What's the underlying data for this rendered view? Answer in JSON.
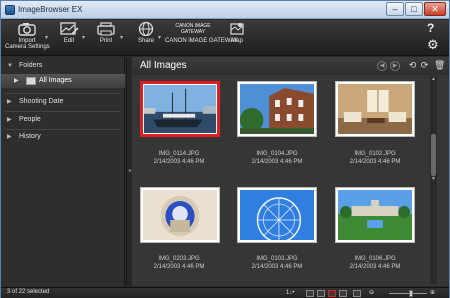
{
  "window": {
    "title": "ImageBrowser EX",
    "min": "–",
    "max": "□",
    "close": "✕"
  },
  "toolbar": {
    "items": [
      {
        "label1": "Import",
        "label2": "Camera Settings",
        "icon": "camera-icon"
      },
      {
        "label1": "Edit",
        "label2": "",
        "icon": "edit-icon"
      },
      {
        "label1": "Print",
        "label2": "",
        "icon": "printer-icon"
      },
      {
        "label1": "Share",
        "label2": "",
        "icon": "globe-icon"
      },
      {
        "label1": "CANON iMAGE GATEWAY",
        "label2": "",
        "icon": "canon-image-gateway-icon",
        "logo": "CANON iMAGE GATEWAY"
      },
      {
        "label1": "Map",
        "label2": "",
        "icon": "map-icon"
      }
    ],
    "help": "?",
    "settings": "⚙"
  },
  "sidebar": {
    "sections": [
      {
        "label": "Folders",
        "expanded": true
      },
      {
        "label": "Shooting Date",
        "expanded": false
      },
      {
        "label": "People",
        "expanded": false
      },
      {
        "label": "History",
        "expanded": false
      }
    ],
    "folder_item": "All Images",
    "splitter_grip": "◂"
  },
  "main": {
    "title": "All Images",
    "thumbnails": [
      {
        "file": "IMG_0114.JPG",
        "date": "2/14/2003 4:46 PM",
        "selected": true,
        "scene": "harbor-boat"
      },
      {
        "file": "IMG_0104.JPG",
        "date": "2/14/2003 4:46 PM",
        "selected": false,
        "scene": "brick-building"
      },
      {
        "file": "IMG_0102.JPG",
        "date": "2/14/2003 4:46 PM",
        "selected": false,
        "scene": "living-room"
      },
      {
        "file": "IMG_0203.JPG",
        "date": "2/14/2003 4:46 PM",
        "selected": false,
        "scene": "fisheye-window"
      },
      {
        "file": "IMG_0103.JPG",
        "date": "2/14/2003 4:46 PM",
        "selected": false,
        "scene": "ferris-wheel"
      },
      {
        "file": "IMG_0106.JPG",
        "date": "2/14/2003 4:46 PM",
        "selected": false,
        "scene": "palace-garden"
      }
    ]
  },
  "statusbar": {
    "selection": "3 of 22 selected",
    "filter_label": "1↓•"
  },
  "colors": {
    "selection_border": "#e02020",
    "panel_bg": "#363636",
    "sidebar_bg": "#2e2e2e"
  }
}
